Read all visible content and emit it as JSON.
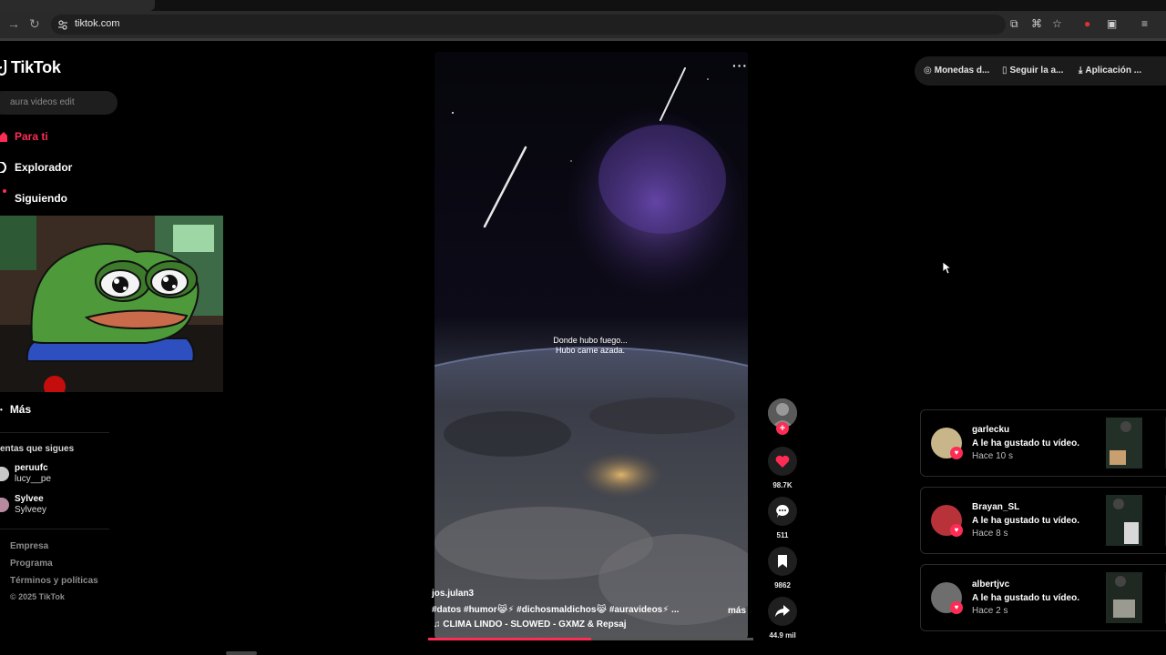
{
  "browser": {
    "url": "tiktok.com",
    "back_icon": "arrow-right-icon",
    "reload_icon": "reload-icon"
  },
  "brand": {
    "name": "TikTok",
    "accent": "#fe2c55"
  },
  "search": {
    "placeholder": "aura videos edit"
  },
  "nav": {
    "for_you": "Para ti",
    "explore": "Explorador",
    "following": "Siguiendo",
    "more": "Más"
  },
  "followed": {
    "title": "entas que sigues",
    "accounts": [
      {
        "name": "peruufc",
        "handle": "lucy__pe"
      },
      {
        "name": "Sylvee",
        "handle": "Sylveey"
      }
    ]
  },
  "footer": {
    "company": "Empresa",
    "program": "Programa",
    "terms": "Términos y políticas",
    "copyright": "© 2025 TikTok"
  },
  "video": {
    "caption_line1": "Donde hubo fuego...",
    "caption_line2": "Hubo carne azada.",
    "author": "jos.julan3",
    "hashtags": "#datos  #humor😹⚡  #dichosmaldichos😹  #auravideos⚡ ...",
    "more": "más",
    "music": "♫  CLIMA LINDO - SLOWED - GXMZ & Repsaj",
    "progress": 0.5,
    "likes": "98.7K",
    "comments": "511",
    "saves": "9862",
    "shares": "44.9 mil"
  },
  "top_links": {
    "coins": "Monedas d...",
    "follow_app": "Seguir la a...",
    "app": "Aplicación ..."
  },
  "notifications": [
    {
      "name": "garlecku",
      "message": "A le ha gustado tu vídeo.",
      "time": "Hace 10 s",
      "avatar_color": "#c8b58a"
    },
    {
      "name": "Brayan_SL",
      "message": "A le ha gustado tu vídeo.",
      "time": "Hace 8 s",
      "avatar_color": "#b8323a"
    },
    {
      "name": "albertjvc",
      "message": "A le ha gustado tu vídeo.",
      "time": "Hace 2 s",
      "avatar_color": "#6e6e6e"
    }
  ]
}
